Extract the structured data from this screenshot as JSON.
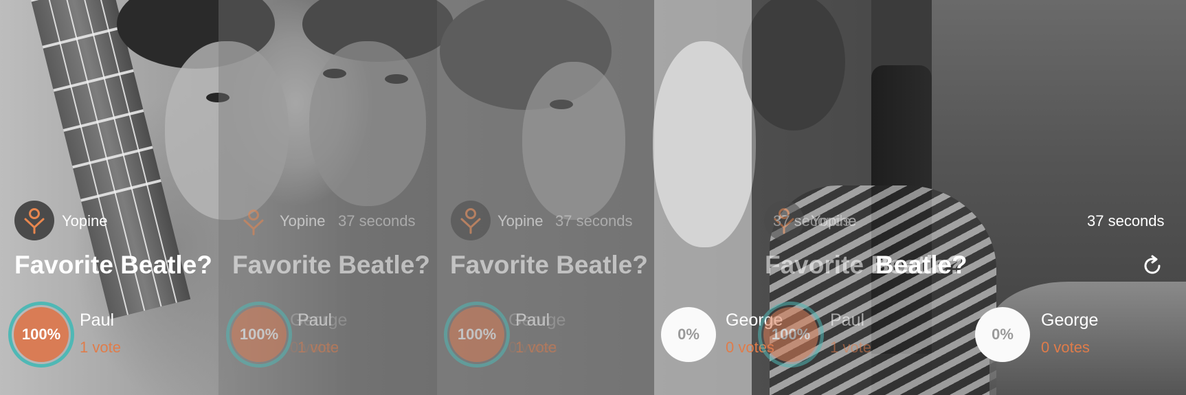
{
  "poll": {
    "author": "Yopine",
    "elapsed": "37 seconds",
    "question": "Favorite Beatle?",
    "options": [
      {
        "name": "Paul",
        "percent_label": "100%",
        "percent": 100,
        "votes_label": "1 vote"
      },
      {
        "name": "George",
        "percent_label": "0%",
        "percent": 0,
        "votes_label": "0 votes"
      }
    ]
  },
  "colors": {
    "accent": "#e07c4a",
    "winner_fill": "#d97c55",
    "ring": "#4fb8b5",
    "text": "#ffffff"
  },
  "icons": {
    "avatar": "yopine-logo-icon",
    "refresh": "refresh-icon"
  }
}
